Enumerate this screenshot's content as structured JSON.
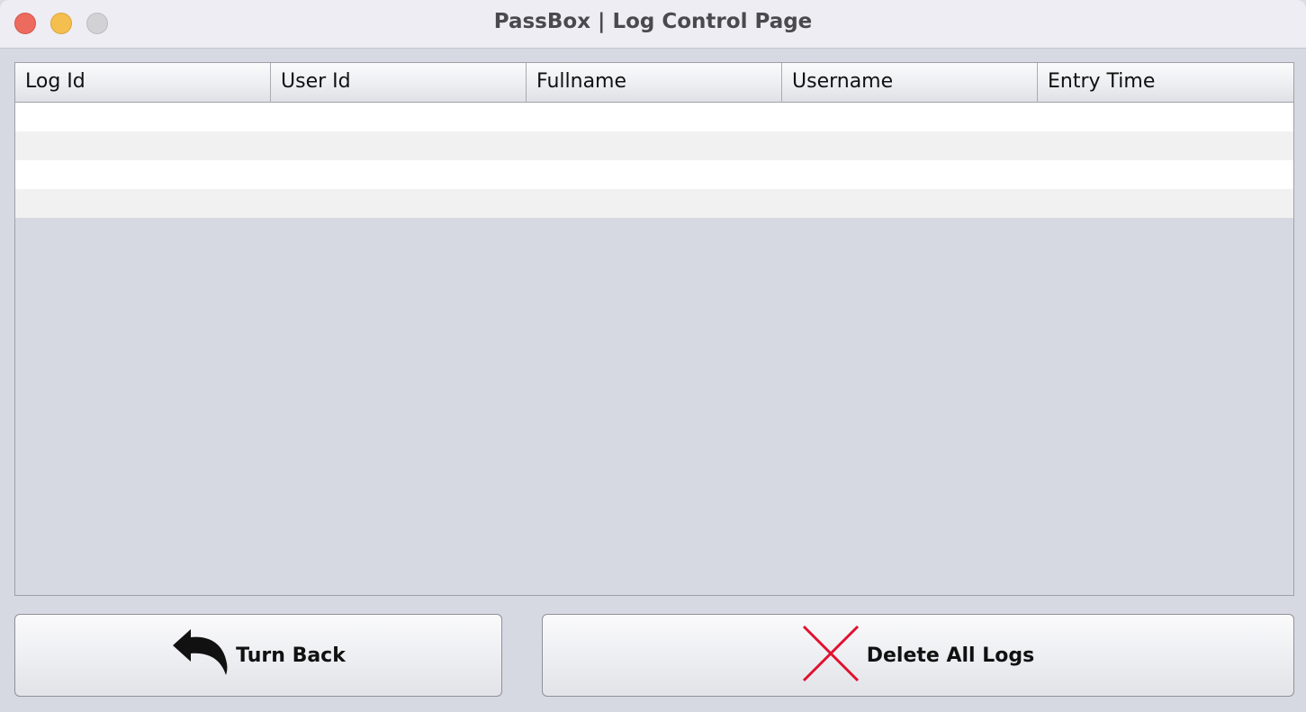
{
  "window": {
    "title": "PassBox | Log Control Page"
  },
  "table": {
    "columns": [
      "Log Id",
      "User Id",
      "Fullname",
      "Username",
      "Entry Time"
    ],
    "rows": []
  },
  "buttons": {
    "turn_back_label": "Turn Back",
    "delete_all_label": "Delete All Logs"
  },
  "icons": {
    "turn_back": "undo-arrow-icon",
    "delete_all": "red-x-icon"
  },
  "colors": {
    "close": "#ed6a5e",
    "minimize": "#f5bf4f",
    "delete_icon": "#e0102f"
  }
}
